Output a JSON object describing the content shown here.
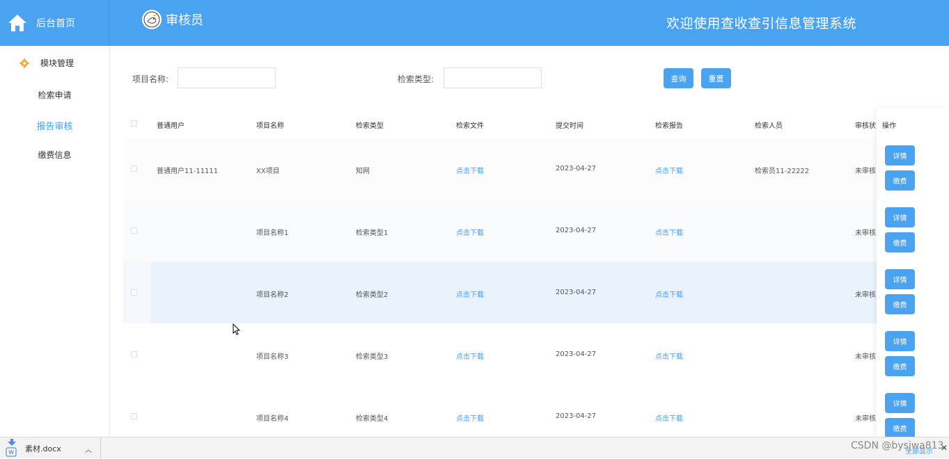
{
  "header": {
    "home_label": "后台首页",
    "role_name": "审核员",
    "welcome": "欢迎使用查收查引信息管理系统"
  },
  "sidebar": {
    "group_label": "模块管理",
    "items": [
      {
        "label": "检索申请"
      },
      {
        "label": "报告审核"
      },
      {
        "label": "缴费信息"
      }
    ]
  },
  "search": {
    "project_label": "项目名称:",
    "type_label": "检索类型:",
    "query_button": "查询",
    "reset_button": "重置"
  },
  "table": {
    "headers": [
      "普通用户",
      "项目名称",
      "检索类型",
      "检索文件",
      "提交时间",
      "检索报告",
      "检索人员",
      "审核状",
      "操作"
    ],
    "rows": [
      {
        "user": "普通用户11-11111",
        "project": "XX项目",
        "type": "知网",
        "file": "点击下载",
        "time": "2023-04-27",
        "report": "点击下载",
        "staff": "检索员11-22222",
        "status": "未审核"
      },
      {
        "user": "",
        "project": "项目名称1",
        "type": "检索类型1",
        "file": "点击下载",
        "time": "2023-04-27",
        "report": "点击下载",
        "staff": "",
        "status": "未审核"
      },
      {
        "user": "",
        "project": "项目名称2",
        "type": "检索类型2",
        "file": "点击下载",
        "time": "2023-04-27",
        "report": "点击下载",
        "staff": "",
        "status": "未审核"
      },
      {
        "user": "",
        "project": "项目名称3",
        "type": "检索类型3",
        "file": "点击下载",
        "time": "2023-04-27",
        "report": "点击下载",
        "staff": "",
        "status": "未审核"
      },
      {
        "user": "",
        "project": "项目名称4",
        "type": "检索类型4",
        "file": "点击下载",
        "time": "2023-04-27",
        "report": "点击下载",
        "staff": "",
        "status": "未审核"
      }
    ],
    "detail_label": "详情",
    "pay_label": "缴费"
  },
  "download_bar": {
    "file_name": "素材.docx",
    "show_all": "全部显示"
  },
  "watermark": "CSDN @bysjwa813",
  "colors": {
    "primary": "#4aa3f1",
    "link": "#409eff",
    "row_hover": "#eaf3fc"
  }
}
